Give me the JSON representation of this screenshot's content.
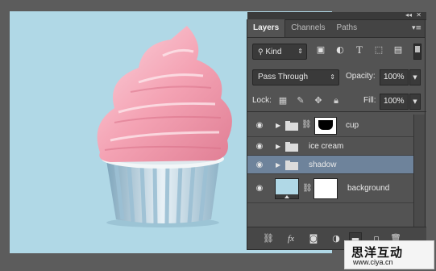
{
  "panel": {
    "tabs": [
      {
        "label": "Layers"
      },
      {
        "label": "Channels"
      },
      {
        "label": "Paths"
      }
    ],
    "filter": {
      "kind_label": "Kind"
    },
    "blend": {
      "mode": "Pass Through",
      "opacity_label": "Opacity:",
      "opacity_value": "100%"
    },
    "lock": {
      "label": "Lock:",
      "fill_label": "Fill:",
      "fill_value": "100%"
    },
    "layers": [
      {
        "name": "cup",
        "type": "group",
        "selected": false,
        "masked": true
      },
      {
        "name": "ice cream",
        "type": "group",
        "selected": false,
        "masked": false
      },
      {
        "name": "shadow",
        "type": "group",
        "selected": true,
        "masked": false
      },
      {
        "name": "background",
        "type": "layer",
        "selected": false,
        "masked": true
      }
    ],
    "icons": {
      "filter": [
        "image-filter-icon",
        "adjustment-filter-icon",
        "type-filter-icon",
        "shape-filter-icon",
        "smart-object-filter-icon"
      ],
      "lock": [
        "lock-transparent-icon",
        "lock-image-icon",
        "lock-position-icon",
        "lock-all-icon"
      ],
      "bottom": [
        "link-layers-icon",
        "fx-icon",
        "add-mask-icon",
        "adjustment-layer-icon",
        "new-group-icon",
        "new-layer-icon",
        "delete-layer-icon"
      ]
    }
  },
  "colors": {
    "canvas_bg": "#b0d8e6",
    "selected_layer": "#6e839b",
    "panel_bg": "#535353"
  },
  "watermark": {
    "cn": "思洋互动",
    "url": "www.ciya.cn"
  }
}
